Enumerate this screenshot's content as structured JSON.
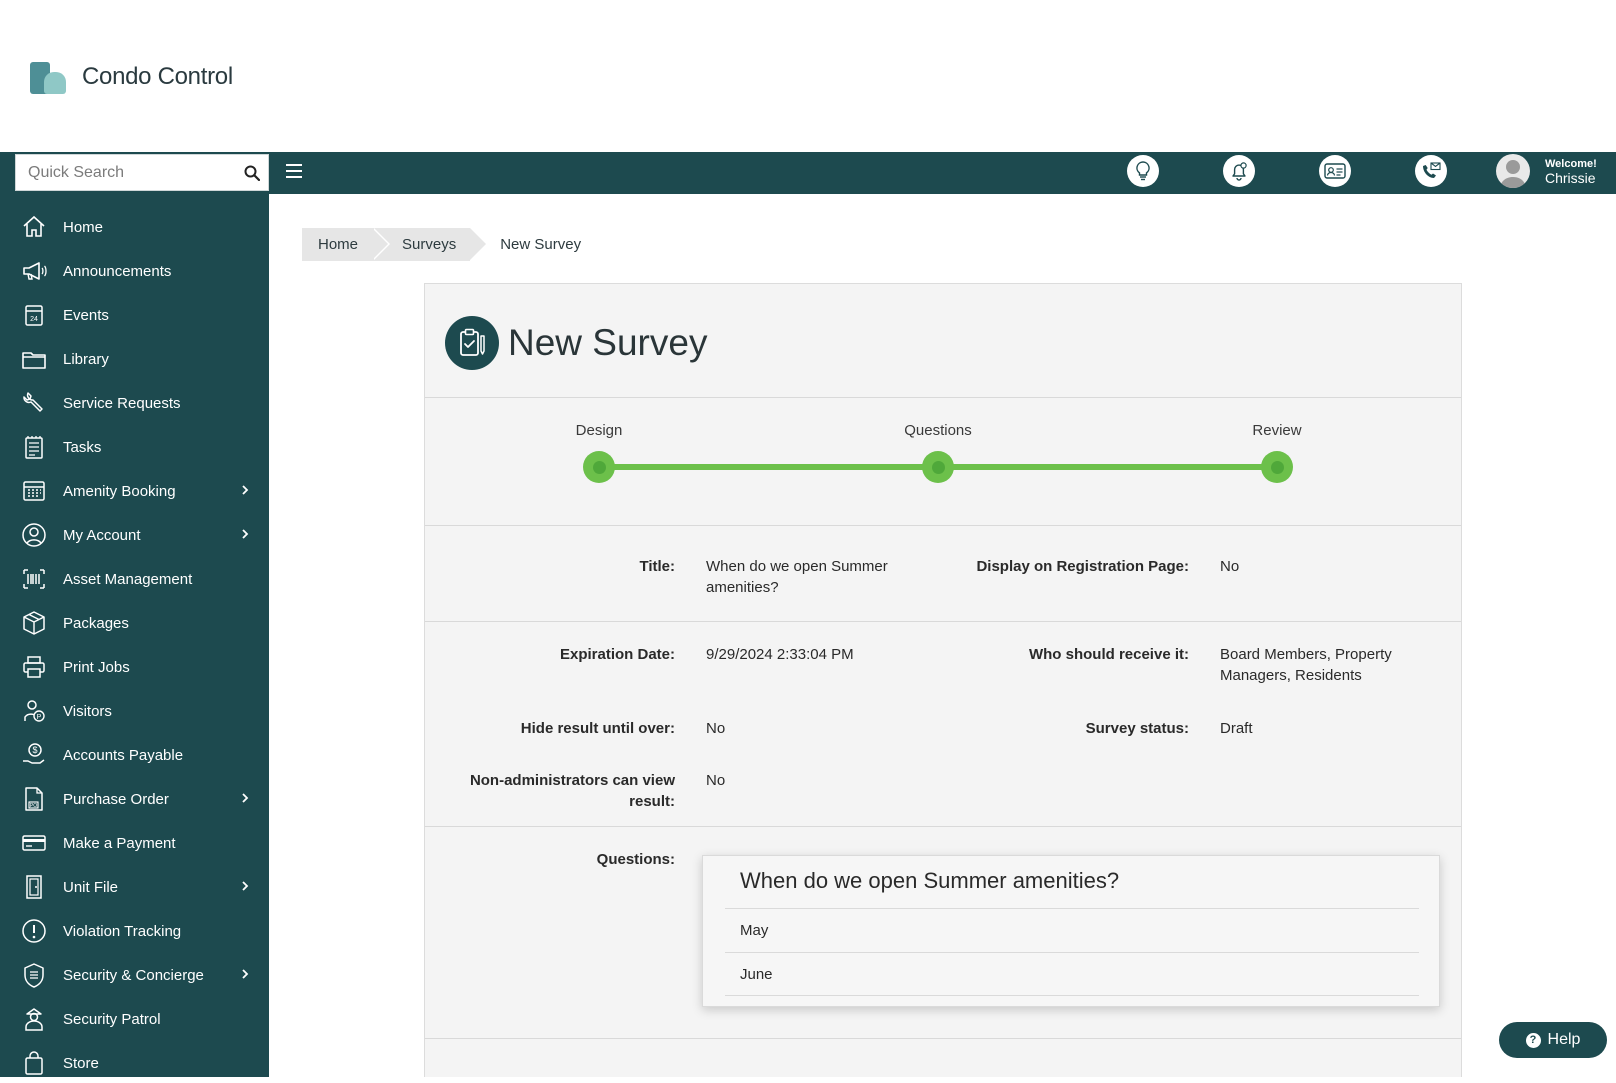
{
  "brand": {
    "name": "Condo Control"
  },
  "topbar": {
    "search_placeholder": "Quick Search",
    "icons": [
      "lightbulb-icon",
      "bell-icon",
      "id-card-icon",
      "phone-mail-icon"
    ],
    "welcome": "Welcome!",
    "user": "Chrissie"
  },
  "sidebar": {
    "items": [
      {
        "label": "Home",
        "icon": "home-icon",
        "submenu": false
      },
      {
        "label": "Announcements",
        "icon": "megaphone-icon",
        "submenu": false
      },
      {
        "label": "Events",
        "icon": "calendar-icon",
        "submenu": false
      },
      {
        "label": "Library",
        "icon": "folder-icon",
        "submenu": false
      },
      {
        "label": "Service Requests",
        "icon": "wrench-icon",
        "submenu": false
      },
      {
        "label": "Tasks",
        "icon": "checklist-icon",
        "submenu": false
      },
      {
        "label": "Amenity Booking",
        "icon": "calendar-grid-icon",
        "submenu": true
      },
      {
        "label": "My Account",
        "icon": "user-circle-icon",
        "submenu": true
      },
      {
        "label": "Asset Management",
        "icon": "barcode-icon",
        "submenu": false
      },
      {
        "label": "Packages",
        "icon": "package-icon",
        "submenu": false
      },
      {
        "label": "Print Jobs",
        "icon": "printer-icon",
        "submenu": false
      },
      {
        "label": "Visitors",
        "icon": "visitor-icon",
        "submenu": false
      },
      {
        "label": "Accounts Payable",
        "icon": "money-hand-icon",
        "submenu": false
      },
      {
        "label": "Purchase Order",
        "icon": "po-document-icon",
        "submenu": true
      },
      {
        "label": "Make a Payment",
        "icon": "credit-card-icon",
        "submenu": false
      },
      {
        "label": "Unit File",
        "icon": "door-icon",
        "submenu": true
      },
      {
        "label": "Violation Tracking",
        "icon": "exclamation-icon",
        "submenu": false
      },
      {
        "label": "Security & Concierge",
        "icon": "shield-icon",
        "submenu": true
      },
      {
        "label": "Security Patrol",
        "icon": "guard-icon",
        "submenu": false
      },
      {
        "label": "Store",
        "icon": "shopping-bag-icon",
        "submenu": false
      }
    ]
  },
  "breadcrumb": {
    "home": "Home",
    "surveys": "Surveys",
    "current": "New Survey"
  },
  "page": {
    "title": "New Survey"
  },
  "steps": [
    "Design",
    "Questions",
    "Review"
  ],
  "details": {
    "title_label": "Title:",
    "title_value": "When do we open Summer amenities?",
    "display_label": "Display on Registration Page:",
    "display_value": "No",
    "expiration_label": "Expiration Date:",
    "expiration_value": "9/29/2024 2:33:04 PM",
    "receive_label": "Who should receive it:",
    "receive_value": "Board Members, Property Managers, Residents",
    "hide_label": "Hide result until over:",
    "hide_value": "No",
    "status_label": "Survey status:",
    "status_value": "Draft",
    "nonadmin_label": "Non-administrators can view result:",
    "nonadmin_value": "No"
  },
  "questions": {
    "label": "Questions:",
    "question": "When do we open Summer amenities?",
    "options": [
      "May",
      "June"
    ]
  },
  "help": {
    "label": "Help"
  },
  "colors": {
    "primary": "#1d4a4f",
    "progress": "#6cc04a",
    "card_bg": "#f4f4f4"
  }
}
